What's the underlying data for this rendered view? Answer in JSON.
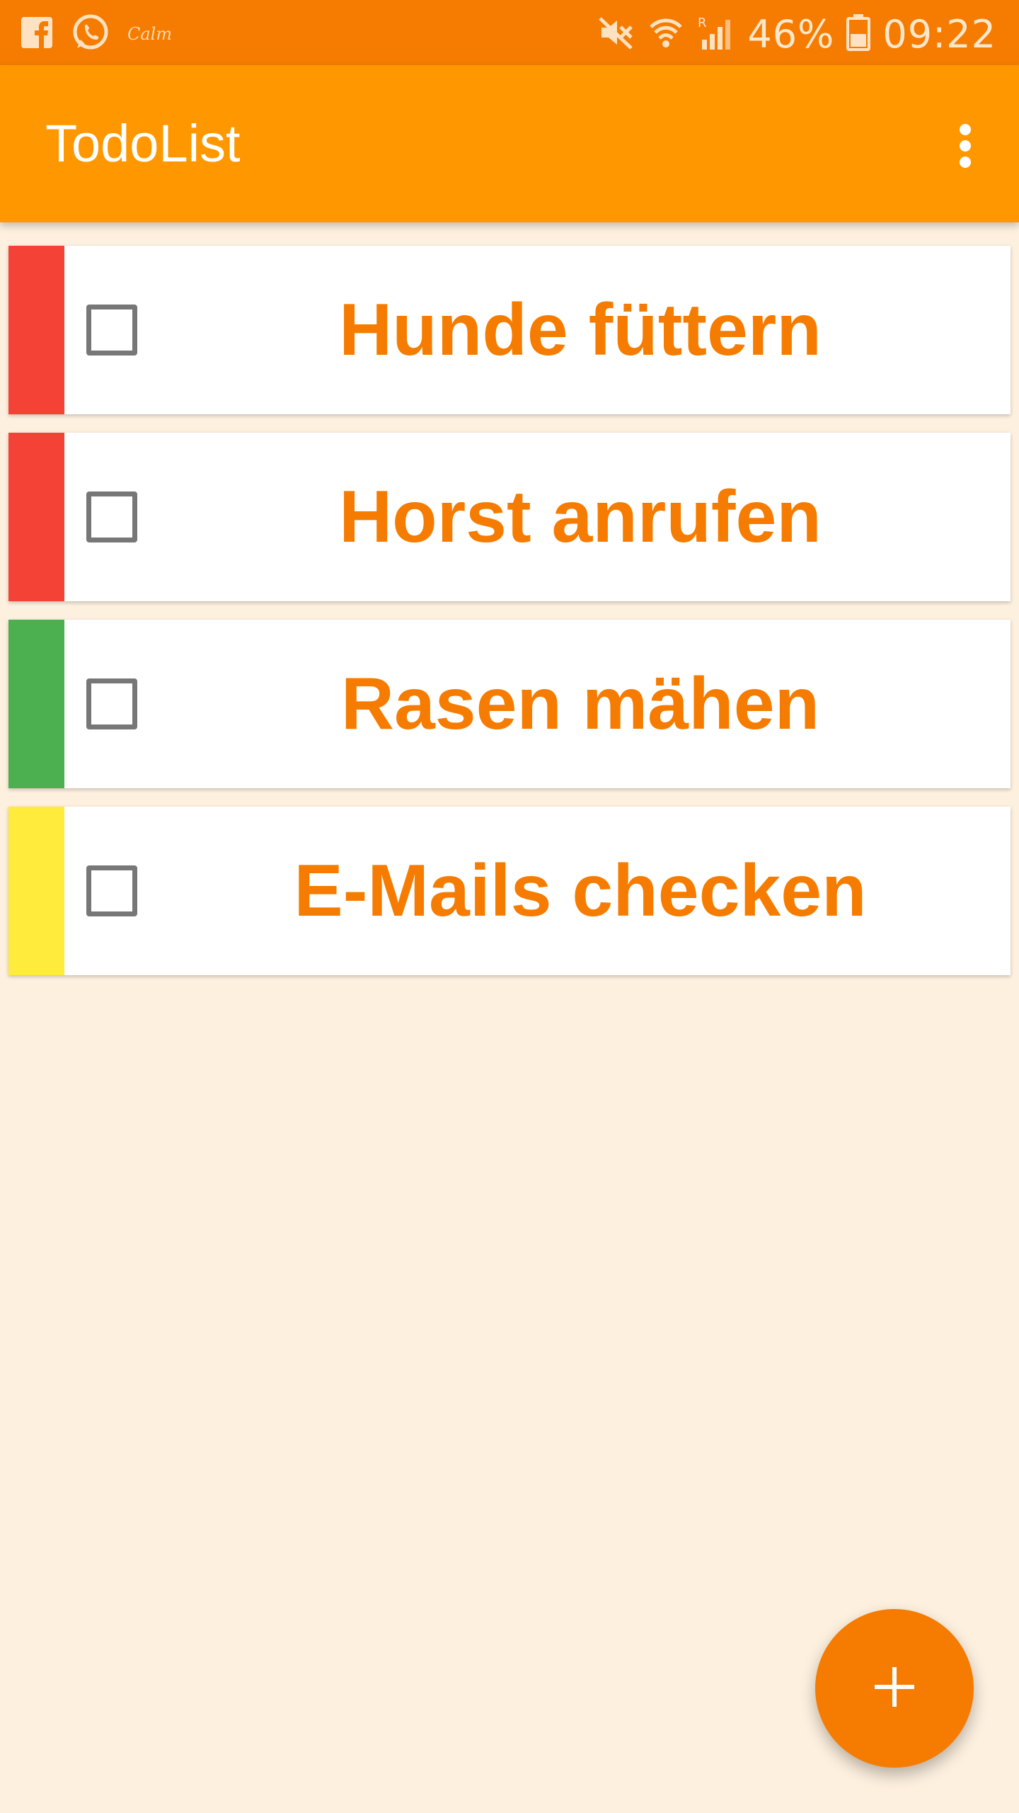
{
  "status_bar": {
    "calm_label": "Calm",
    "battery": "46%",
    "time": "09:22",
    "icons": [
      "facebook-icon",
      "whatsapp-icon",
      "mute-icon",
      "wifi-icon",
      "signal-icon",
      "battery-icon"
    ]
  },
  "app_bar": {
    "title": "TodoList",
    "overflow_icon": "more-vert-icon"
  },
  "todos": [
    {
      "title": "Hunde füttern",
      "priority_color": "#f44336",
      "checked": false
    },
    {
      "title": "Horst anrufen",
      "priority_color": "#f44336",
      "checked": false
    },
    {
      "title": "Rasen mähen",
      "priority_color": "#4caf50",
      "checked": false
    },
    {
      "title": "E-Mails checken",
      "priority_color": "#ffeb3b",
      "checked": false
    }
  ],
  "fab": {
    "icon": "plus-icon"
  },
  "colors": {
    "status_bar": "#f57c00",
    "app_bar": "#ff9800",
    "background": "#fdf0df",
    "accent": "#f57c00"
  }
}
